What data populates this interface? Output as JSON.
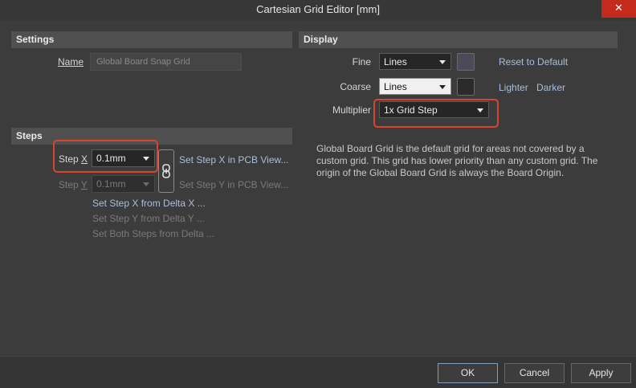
{
  "window": {
    "title": "Cartesian Grid Editor [mm]",
    "close_glyph": "✕"
  },
  "settings": {
    "header": "Settings",
    "name_label": "Name",
    "name_value": "Global Board Snap Grid"
  },
  "steps": {
    "header": "Steps",
    "step_x_label_prefix": "Step ",
    "step_x_label_key": "X",
    "step_x_value": "0.1mm",
    "step_y_label_prefix": "Step ",
    "step_y_label_key": "Y",
    "step_y_value": "0.1mm",
    "link_icon": "link-icon",
    "set_x_in_pcb": "Set Step X in PCB View...",
    "set_y_in_pcb": "Set Step Y in PCB View...",
    "set_x_from_delta": "Set Step X from Delta X ...",
    "set_y_from_delta": "Set Step Y from Delta Y ...",
    "set_both_from_delta": "Set Both Steps from Delta ..."
  },
  "display": {
    "header": "Display",
    "fine_label": "Fine",
    "fine_value": "Lines",
    "fine_color": "#4a4a58",
    "coarse_label": "Coarse",
    "coarse_value": "Lines",
    "coarse_color": "#2a2a2a",
    "multiplier_label": "Multiplier",
    "multiplier_value": "1x Grid Step",
    "reset_to_default": "Reset to Default",
    "lighter": "Lighter",
    "darker": "Darker",
    "description": "Global Board Grid is the default grid for areas not covered by a custom grid. This grid has lower priority than any custom grid. The origin of the Global Board Grid is always the Board Origin."
  },
  "buttons": {
    "ok": "OK",
    "cancel": "Cancel",
    "apply": "Apply"
  },
  "colors": {
    "highlight": "#d9452c",
    "link": "#a9bfdc"
  }
}
